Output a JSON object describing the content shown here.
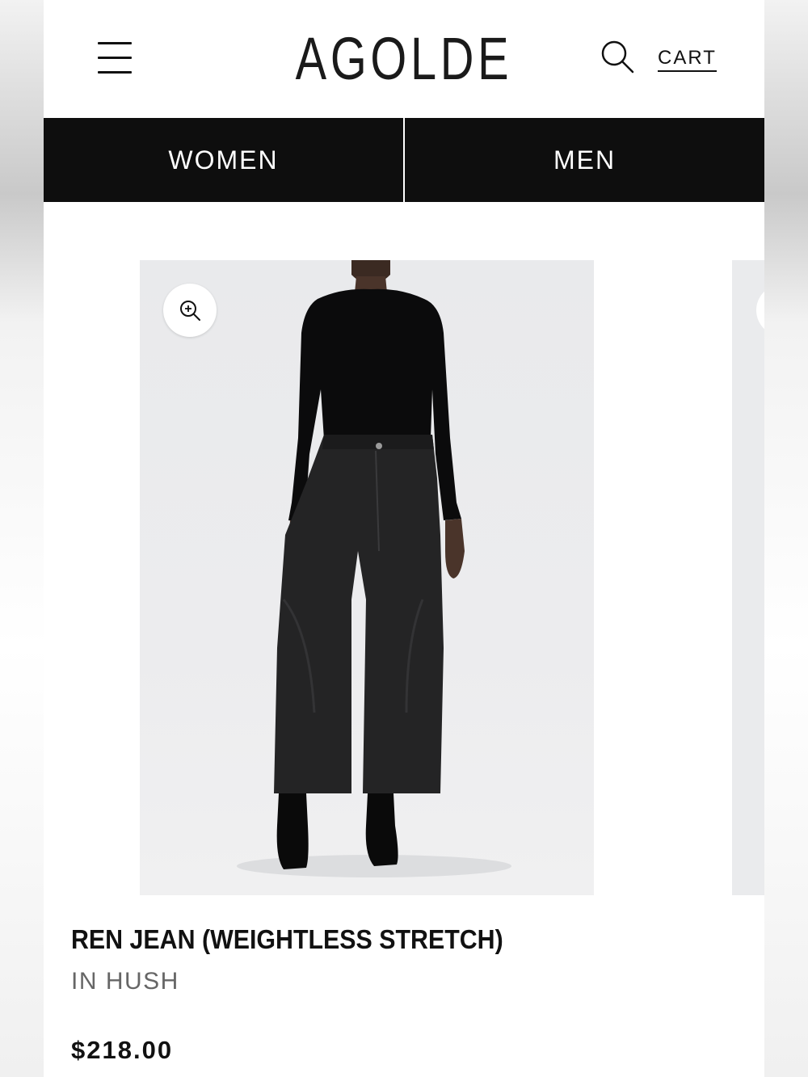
{
  "header": {
    "menu_icon": "hamburger-menu-icon",
    "logo": "AGOLDE",
    "search_icon": "search-icon",
    "cart_label": "CART"
  },
  "nav": {
    "tabs": [
      {
        "label": "WOMEN"
      },
      {
        "label": "MEN"
      }
    ]
  },
  "product": {
    "zoom_icon": "zoom-in-icon",
    "title": "REN JEAN (WEIGHTLESS STRETCH)",
    "color": "IN HUSH",
    "price": "$218.00"
  },
  "colors": {
    "nav_background": "#0e0e0e",
    "text_primary": "#111111",
    "text_secondary": "#666666",
    "image_background": "#e9eaec"
  }
}
